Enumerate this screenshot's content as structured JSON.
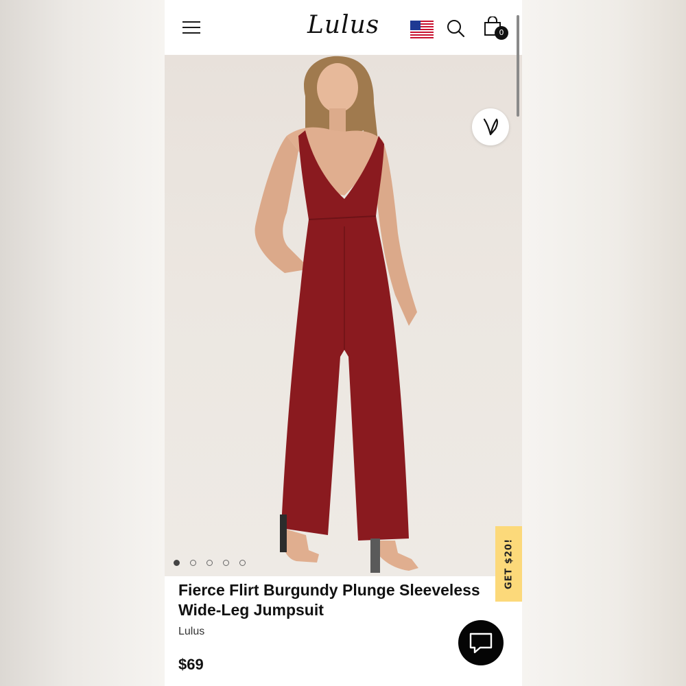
{
  "header": {
    "logo_text": "Lulus",
    "cart_count": "0",
    "icons": [
      "menu-icon",
      "us-flag-icon",
      "search-icon",
      "shopping-bag-icon"
    ]
  },
  "gallery": {
    "image_count": 5,
    "active_index": 0
  },
  "promo": {
    "label": "GET $20!",
    "color": "#fcd97a"
  },
  "product": {
    "title": "Fierce Flirt Burgundy Plunge Sleeveless Wide-Leg Jumpsuit",
    "brand": "Lulus",
    "price": "$69",
    "garment_color": "#8a1a1f"
  },
  "chat": {
    "icon": "chat-bubble-icon"
  }
}
